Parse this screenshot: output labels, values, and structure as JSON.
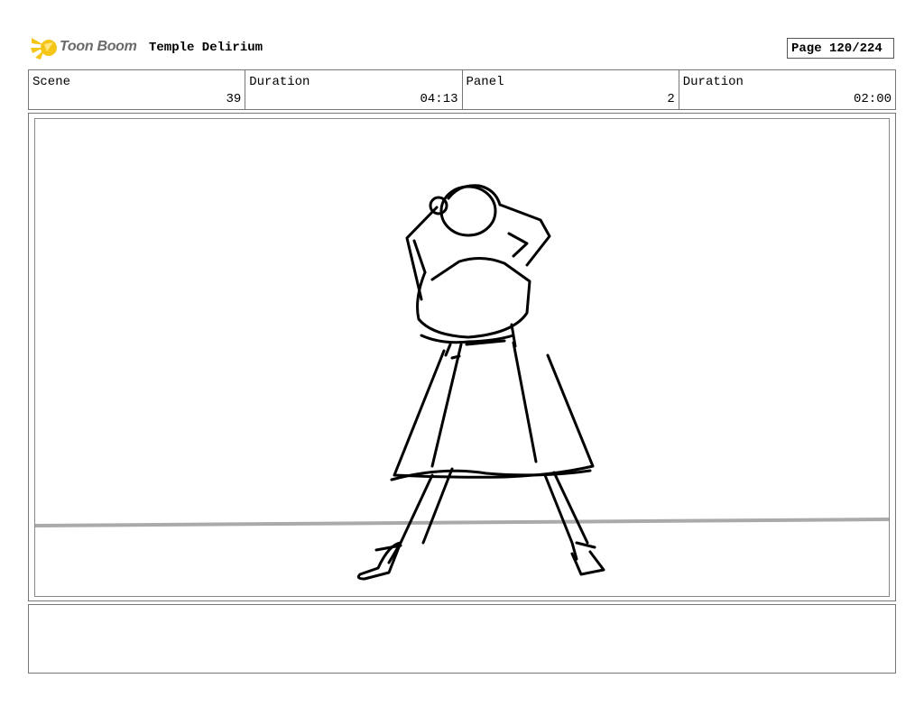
{
  "header": {
    "brand": "Toon Boom",
    "project_title": "Temple Delirium",
    "page_label": "Page 120/224"
  },
  "info": {
    "scene_label": "Scene",
    "scene_value": "39",
    "scene_duration_label": "Duration",
    "scene_duration_value": "04:13",
    "panel_label": "Panel",
    "panel_value": "2",
    "panel_duration_label": "Duration",
    "panel_duration_value": "02:00"
  },
  "notes": {
    "text": ""
  },
  "colors": {
    "logo_accent": "#f5c518",
    "border": "#777777",
    "horizon_line": "#aaaaaa"
  },
  "icons": {
    "logo": "toon-boom-star-icon"
  }
}
